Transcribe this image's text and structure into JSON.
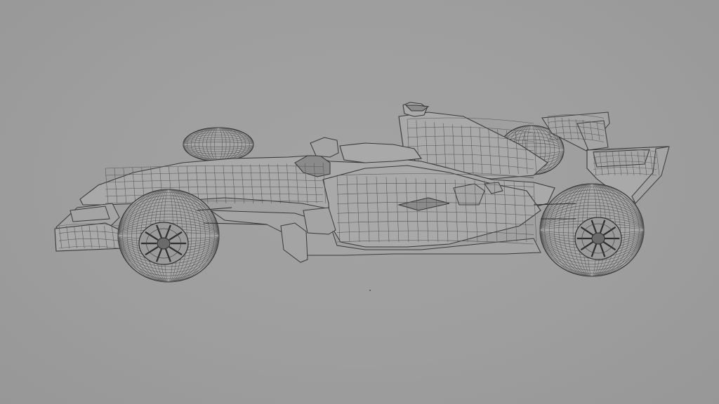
{
  "viewport": {
    "background_color": "#9e9e9e",
    "render_mode": "wireframe-on-shaded"
  },
  "model": {
    "subject": "formula-one-car",
    "view": "side",
    "wire_color": "#3a3a3a",
    "surface_color": "#a9a9a9"
  }
}
